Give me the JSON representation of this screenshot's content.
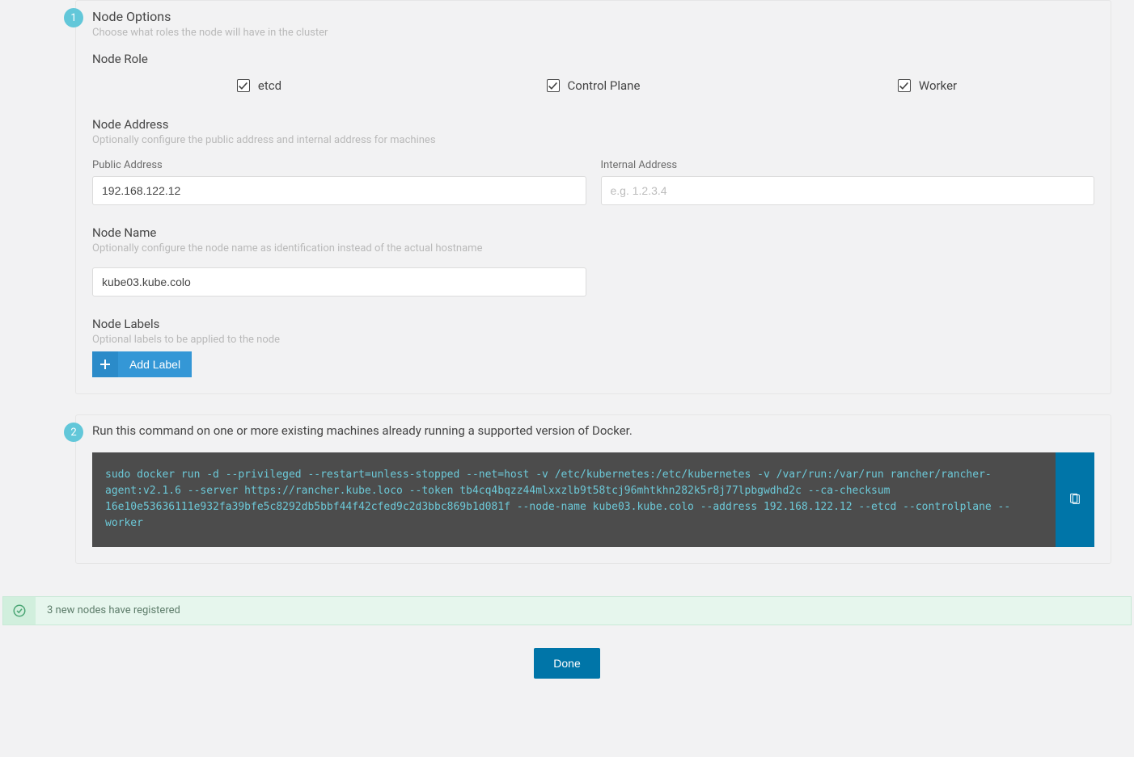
{
  "step1": {
    "badge": "1",
    "title": "Node Options",
    "desc": "Choose what roles the node will have in the cluster",
    "role": {
      "title": "Node Role",
      "etcd": "etcd",
      "controlPlane": "Control Plane",
      "worker": "Worker"
    },
    "address": {
      "title": "Node Address",
      "desc": "Optionally configure the public address and internal address for machines",
      "publicLabel": "Public Address",
      "publicValue": "192.168.122.12",
      "internalLabel": "Internal Address",
      "internalPlaceholder": "e.g. 1.2.3.4"
    },
    "name": {
      "title": "Node Name",
      "desc": "Optionally configure the node name as identification instead of the actual hostname",
      "value": "kube03.kube.colo"
    },
    "labels": {
      "title": "Node Labels",
      "desc": "Optional labels to be applied to the node",
      "addBtn": "Add Label"
    }
  },
  "step2": {
    "badge": "2",
    "instruction": "Run this command on one or more existing machines already running a supported version of Docker.",
    "command": "sudo docker run -d --privileged --restart=unless-stopped --net=host -v /etc/kubernetes:/etc/kubernetes -v /var/run:/var/run rancher/rancher-agent:v2.1.6 --server https://rancher.kube.loco --token tb4cq4bqzz44mlxxzlb9t58tcj96mhtkhn282k5r8j77lpbgwdhd2c --ca-checksum 16e10e53636111e932fa39bfe5c8292db5bbf44f42cfed9c2d3bbc869b1d081f --node-name kube03.kube.colo --address 192.168.122.12 --etcd --controlplane --worker"
  },
  "status": {
    "text": "3 new nodes have registered"
  },
  "doneBtn": "Done"
}
